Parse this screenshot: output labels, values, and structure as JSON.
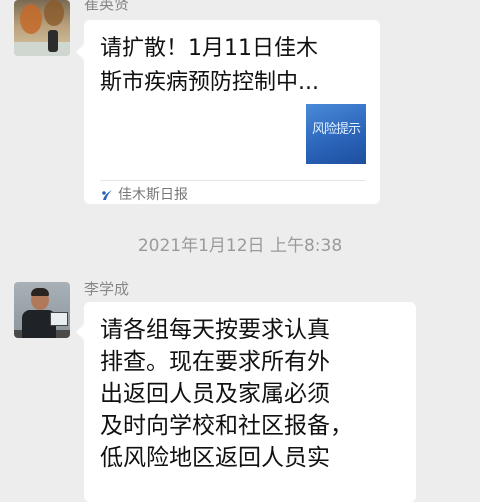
{
  "chat": {
    "messages": [
      {
        "sender": "崔英贤",
        "type": "link_card",
        "card_title": "请扩散！1月11日佳木\n斯市疾病预防控制中...",
        "thumbnail_text": "风险提示",
        "source": "佳木斯日报",
        "source_icon": "newspaper-source-icon"
      },
      {
        "sender": "李学成",
        "type": "text",
        "text": "请各组每天按要求认真\n排查。现在要求所有外\n出返回人员及家属必须\n及时向学校和社区报备，\n低风险地区返回人员实"
      }
    ],
    "timestamp": "2021年1月12日 上午8:38"
  },
  "colors": {
    "background": "#ededed",
    "bubble": "#ffffff",
    "thumbnail": "#2a63b8"
  }
}
